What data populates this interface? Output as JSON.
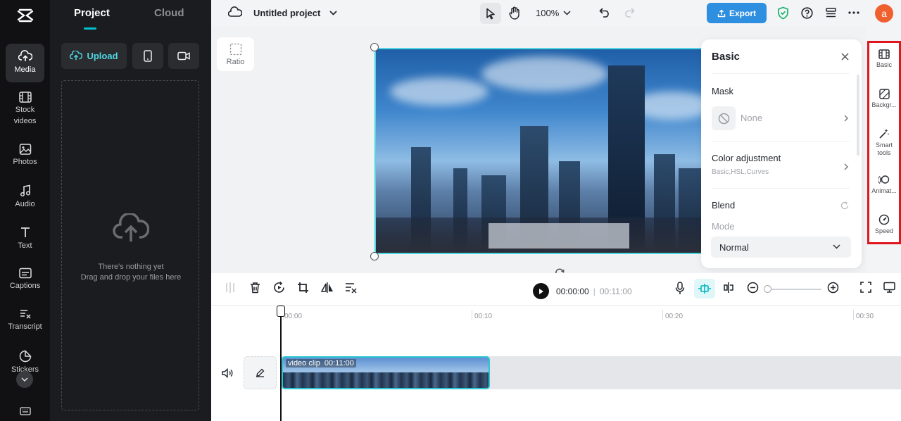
{
  "nav": {
    "items": [
      {
        "label": "Media",
        "icon": "cloud-upload-icon"
      },
      {
        "label": "Stock videos",
        "icon": "film-icon"
      },
      {
        "label": "Photos",
        "icon": "image-icon"
      },
      {
        "label": "Audio",
        "icon": "music-note-icon"
      },
      {
        "label": "Text",
        "icon": "text-t-icon"
      },
      {
        "label": "Captions",
        "icon": "captions-icon"
      },
      {
        "label": "Transcript",
        "icon": "transcript-icon"
      },
      {
        "label": "Stickers",
        "icon": "sticker-icon"
      }
    ]
  },
  "panel": {
    "tabs": [
      "Project",
      "Cloud"
    ],
    "upload_label": "Upload",
    "empty_title": "There's nothing yet",
    "empty_sub": "Drag and drop your files here"
  },
  "topbar": {
    "project_name": "Untitled project",
    "zoom": "100%",
    "export_label": "Export",
    "avatar_letter": "a"
  },
  "stage": {
    "ratio_label": "Ratio"
  },
  "basic_panel": {
    "title": "Basic",
    "mask_label": "Mask",
    "mask_value": "None",
    "color_label": "Color adjustment",
    "color_sub": "Basic,HSL,Curves",
    "blend_label": "Blend",
    "mode_label": "Mode",
    "mode_value": "Normal"
  },
  "right_tools": [
    {
      "label": "Basic",
      "icon": "film-strip-icon"
    },
    {
      "label": "Backgr...",
      "icon": "background-icon"
    },
    {
      "label": "Smart tools",
      "icon": "magic-wand-icon"
    },
    {
      "label": "Animat...",
      "icon": "animation-icon"
    },
    {
      "label": "Speed",
      "icon": "speedometer-icon"
    }
  ],
  "playback": {
    "current": "00:00:00",
    "separator": "|",
    "total": "00:11:00"
  },
  "timeline": {
    "ticks": [
      "00:00",
      "00:10",
      "00:20",
      "00:30"
    ],
    "clip_name": "video clip",
    "clip_duration": "00:11:00"
  },
  "colors": {
    "accent": "#00c1cd",
    "export": "#2e8fe0",
    "highlight_border": "#e0161f",
    "avatar": "#f0602e"
  }
}
